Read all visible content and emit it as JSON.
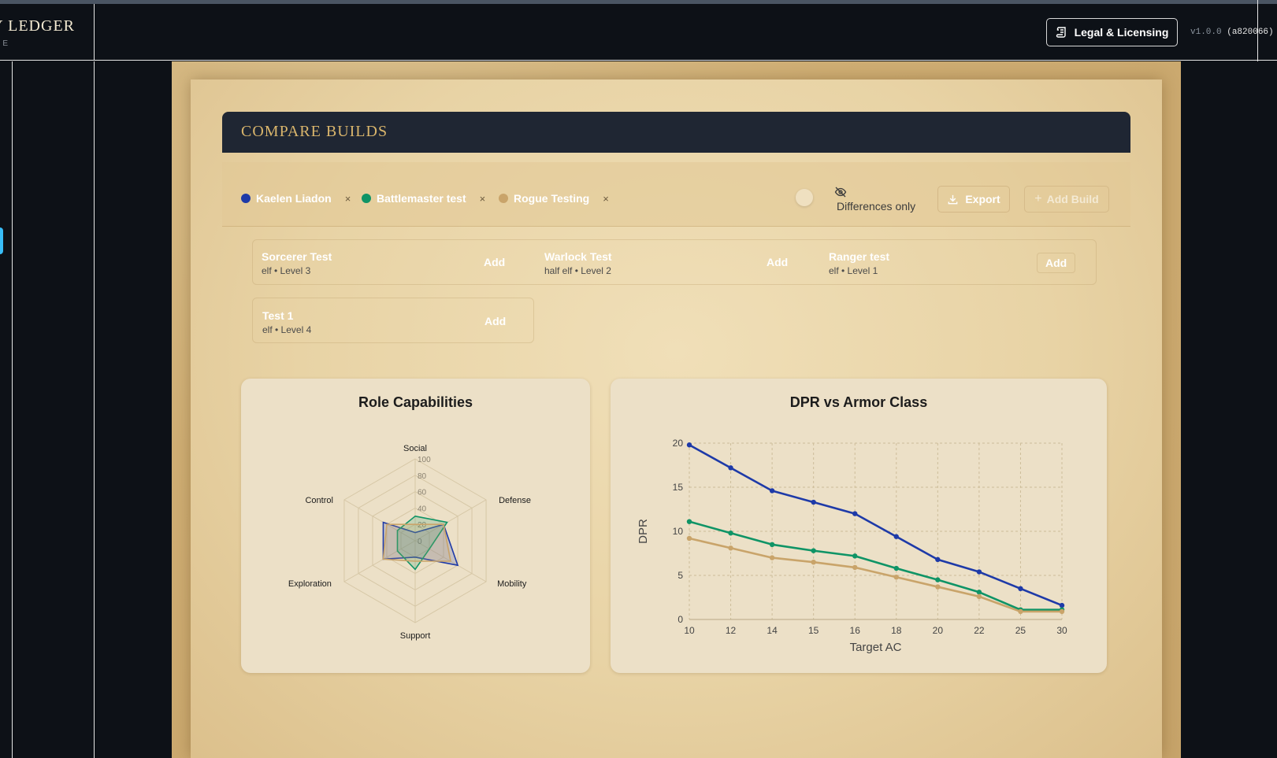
{
  "header": {
    "brand_title": "Y LEDGER",
    "brand_sub": "E",
    "legal_button": "Legal & Licensing",
    "version": "v1.0.0",
    "version_hash": "(a820066) ("
  },
  "compare": {
    "title": "COMPARE BUILDS",
    "selected_builds": [
      {
        "name": "Kaelen Liadon",
        "color": "#1e3aa8",
        "remove": "×"
      },
      {
        "name": "Battlemaster test",
        "color": "#0f9466",
        "remove": "×"
      },
      {
        "name": "Rogue Testing",
        "color": "#c9a46a",
        "remove": "×"
      }
    ],
    "differences_label": "Differences only",
    "export_label": "Export",
    "add_build_label": "Add Build"
  },
  "available_builds": [
    {
      "name": "Sorcerer Test",
      "meta": "elf • Level 3",
      "add": "Add"
    },
    {
      "name": "Warlock Test",
      "meta": "half elf • Level 2",
      "add": "Add"
    },
    {
      "name": "Ranger test",
      "meta": "elf • Level 1",
      "add": "Add"
    },
    {
      "name": "Test 1",
      "meta": "elf • Level 4",
      "add": "Add"
    }
  ],
  "chart_data": [
    {
      "type": "radar",
      "title": "Role Capabilities",
      "axes": [
        "Social",
        "Defense",
        "Mobility",
        "Support",
        "Exploration",
        "Control"
      ],
      "scale_ticks": [
        "0",
        "20",
        "40",
        "60",
        "80",
        "100"
      ],
      "range": [
        0,
        100
      ],
      "series": [
        {
          "color": "#1e3aa8",
          "values": [
            10,
            40,
            60,
            20,
            45,
            45
          ]
        },
        {
          "color": "#0f9466",
          "values": [
            30,
            45,
            20,
            35,
            25,
            25
          ]
        },
        {
          "color": "#c9a46a",
          "values": [
            20,
            40,
            50,
            25,
            45,
            40
          ]
        }
      ]
    },
    {
      "type": "line",
      "title": "DPR vs Armor Class",
      "xlabel": "Target AC",
      "ylabel": "DPR",
      "categories": [
        "10",
        "12",
        "14",
        "15",
        "16",
        "18",
        "20",
        "22",
        "25",
        "30"
      ],
      "ylim": [
        0,
        20
      ],
      "yticks": [
        "0",
        "5",
        "10",
        "15",
        "20"
      ],
      "grid": true,
      "series": [
        {
          "color": "#1e3aa8",
          "values": [
            19.8,
            17.2,
            14.6,
            13.3,
            12.0,
            9.4,
            6.8,
            5.4,
            3.5,
            1.6
          ]
        },
        {
          "color": "#0f9466",
          "values": [
            11.1,
            9.8,
            8.5,
            7.8,
            7.2,
            5.8,
            4.5,
            3.1,
            1.1,
            1.1
          ]
        },
        {
          "color": "#c9a46a",
          "values": [
            9.2,
            8.1,
            7.0,
            6.5,
            5.9,
            4.8,
            3.7,
            2.6,
            0.9,
            0.9
          ]
        }
      ]
    }
  ]
}
